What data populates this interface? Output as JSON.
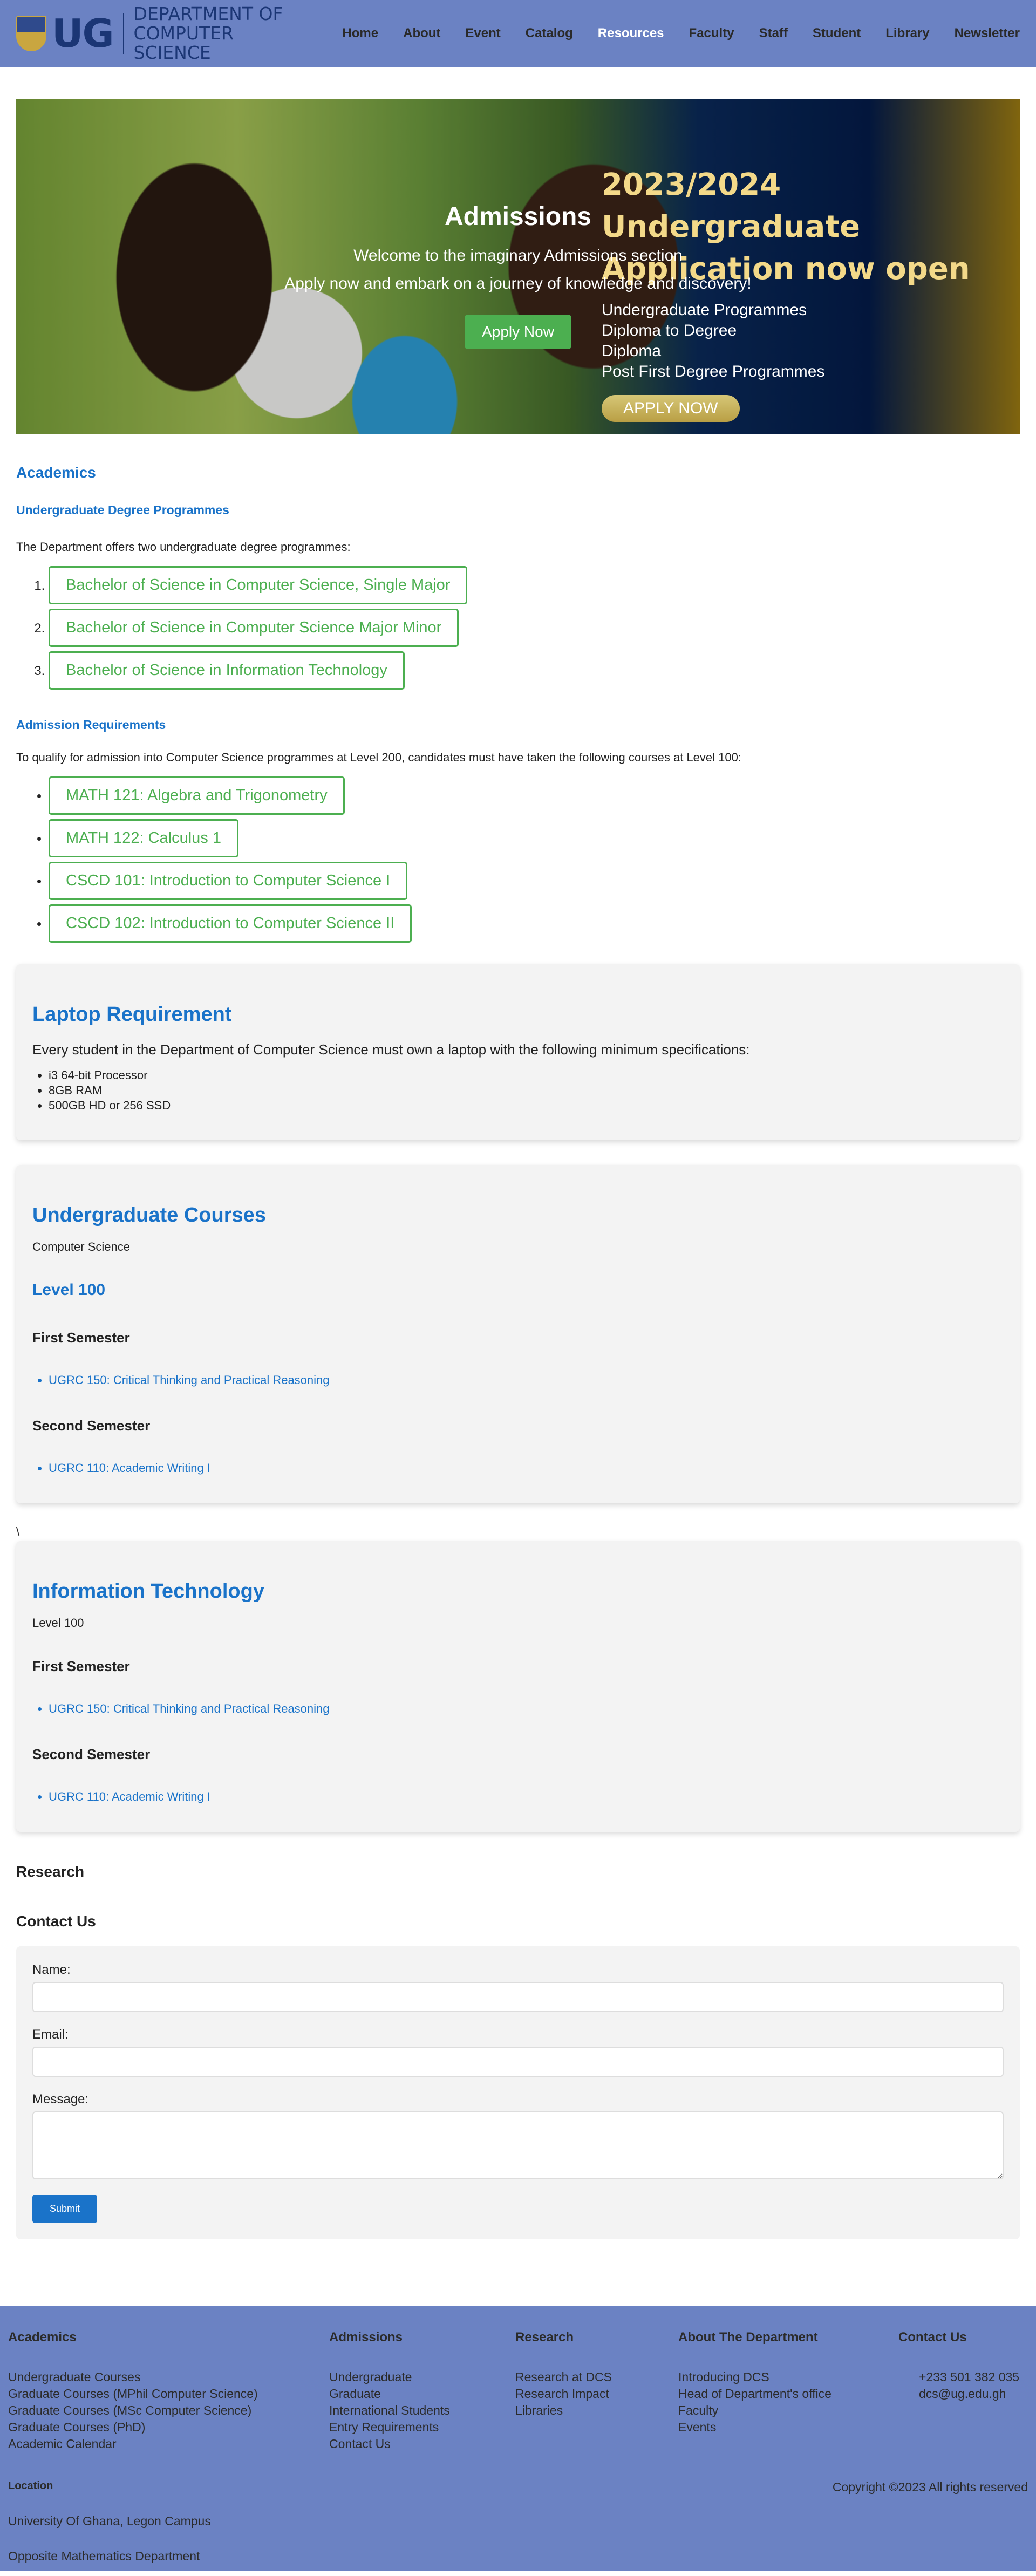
{
  "header": {
    "logo_text": "UG",
    "dept_line1": "DEPARTMENT OF",
    "dept_line2": "COMPUTER SCIENCE",
    "nav": [
      {
        "label": "Home"
      },
      {
        "label": "About"
      },
      {
        "label": "Event"
      },
      {
        "label": "Catalog"
      },
      {
        "label": "Resources",
        "active": true
      },
      {
        "label": "Faculty"
      },
      {
        "label": "Staff"
      },
      {
        "label": "Student"
      },
      {
        "label": "Library"
      },
      {
        "label": "Newsletter"
      }
    ]
  },
  "banner": {
    "title": "Admissions",
    "welcome": "Welcome to the imaginary Admissions section",
    "tagline": "Apply now and embark on a journey of knowledge and discovery!",
    "apply_label": "Apply Now",
    "promo_line1": "2023/2024 Undergraduate",
    "promo_line2": "Application now open",
    "promo_items": [
      "Undergraduate Programmes",
      "Diploma to Degree",
      "Diploma",
      "Post First Degree Programmes"
    ],
    "promo_button": "APPLY NOW"
  },
  "academics": {
    "heading": "Academics",
    "ug_heading": "Undergraduate Degree Programmes",
    "ug_intro": "The Department offers two undergraduate degree programmes:",
    "programmes": [
      "Bachelor of Science in Computer Science, Single Major",
      "Bachelor of Science in Computer Science Major Minor",
      "Bachelor of Science in Information Technology"
    ],
    "req_heading": "Admission Requirements",
    "req_intro": "To qualify for admission into Computer Science programmes at Level 200, candidates must have taken the following courses at Level 100:",
    "requirements": [
      "MATH 121: Algebra and Trigonometry",
      "MATH 122: Calculus 1",
      "CSCD 101: Introduction to Computer Science I",
      "CSCD 102: Introduction to Computer Science II"
    ]
  },
  "laptop": {
    "heading": "Laptop Requirement",
    "lead": "Every student in the Department of Computer Science must own a laptop with the following minimum specifications:",
    "specs": [
      "i3 64-bit Processor",
      "8GB RAM",
      "500GB HD or 256 SSD"
    ]
  },
  "ug_courses": {
    "heading": "Undergraduate Courses",
    "subtitle": "Computer Science",
    "level": "Level 100",
    "sem1": "First Semester",
    "sem1_course": "UGRC 150: Critical Thinking and Practical Reasoning",
    "sem2": "Second Semester",
    "sem2_course": "UGRC 110: Academic Writing I"
  },
  "stray_char": "\\",
  "it_courses": {
    "heading": "Information Technology",
    "level": "Level 100",
    "sem1": "First Semester",
    "sem1_course": "UGRC 150: Critical Thinking and Practical Reasoning",
    "sem2": "Second Semester",
    "sem2_course": "UGRC 110: Academic Writing I"
  },
  "research": {
    "heading": "Research"
  },
  "contact": {
    "heading": "Contact Us",
    "name_label": "Name:",
    "email_label": "Email:",
    "message_label": "Message:",
    "submit_label": "Submit"
  },
  "footer": {
    "academics": {
      "title": "Academics",
      "links": [
        "Undergraduate Courses",
        "Graduate Courses (MPhil Computer Science)",
        "Graduate Courses (MSc Computer Science)",
        "Graduate Courses (PhD)",
        "Academic Calendar"
      ]
    },
    "admissions": {
      "title": "Admissions",
      "links": [
        "Undergraduate",
        "Graduate",
        "International Students",
        "Entry Requirements",
        "Contact Us"
      ]
    },
    "research": {
      "title": "Research",
      "links": [
        "Research at DCS",
        "Research Impact",
        "Libraries"
      ]
    },
    "about": {
      "title": "About The Department",
      "links": [
        "Introducing DCS",
        "Head of Department's office",
        "Faculty",
        "Events"
      ]
    },
    "contact": {
      "title": "Contact Us",
      "links": [
        "+233 501 382 035",
        "dcs@ug.edu.gh"
      ]
    },
    "location_title": "Location",
    "location_line1": "University Of Ghana, Legon Campus",
    "location_line2": "Opposite Mathematics Department",
    "copyright": "Copyright ©2023 All rights reserved"
  },
  "colors": {
    "header_bg": "#6b82c3",
    "accent_blue": "#1a73c9",
    "green": "#4caf50"
  }
}
